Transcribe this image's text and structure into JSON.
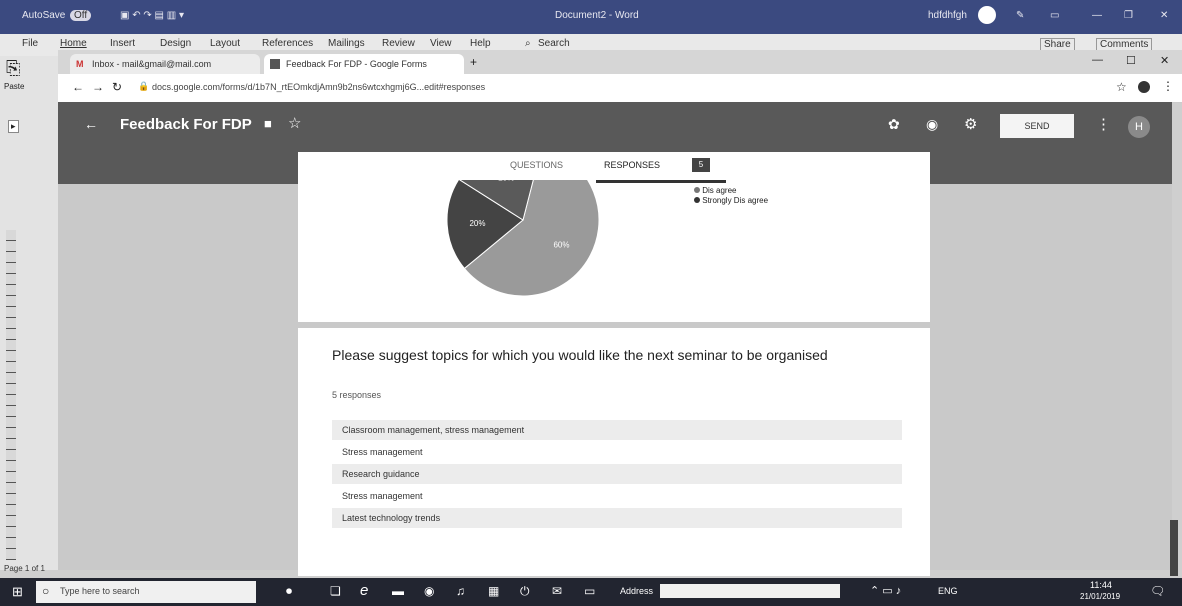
{
  "word": {
    "title": "Document2 - Word",
    "autosave": "AutoSave",
    "autosave_state": "Off",
    "user": "hdfdhfgh",
    "menu": [
      "File",
      "Home",
      "Insert",
      "Design",
      "Layout",
      "References",
      "Mailings",
      "Review",
      "View",
      "Help"
    ],
    "search": "Search",
    "share": "Share",
    "comments": "Comments",
    "paste": "Paste",
    "status_left": "Page 1 of 1"
  },
  "browser": {
    "tabs": [
      {
        "label": "Inbox - mail&gmail@mail.com"
      },
      {
        "label": "Feedback For FDP - Google Forms"
      }
    ],
    "url": "docs.google.com/forms/d/1b7N_rtEOmkdjAmn9b2ns6wtcxhgmj6G...edit#responses"
  },
  "form": {
    "title": "Feedback For FDP",
    "send_label": "SEND",
    "avatar_letter": "H",
    "tabs": {
      "questions": "QUESTIONS",
      "responses": "RESPONSES",
      "responses_count": "5"
    }
  },
  "chart_data": {
    "type": "pie",
    "slices": [
      {
        "label": "",
        "value": 60,
        "color": "#9a9a9a"
      },
      {
        "label": "",
        "value": 20,
        "color": "#444444"
      },
      {
        "label": "",
        "value": 20,
        "color": "#5a5a5a"
      }
    ],
    "slice_labels": [
      "60%",
      "20%",
      "20%"
    ],
    "legend": [
      "Dis agree",
      "Strongly Dis agree"
    ],
    "legend_colors": [
      "#777777",
      "#333333"
    ]
  },
  "question": {
    "text": "Please suggest topics for which you would like the next seminar to be organised",
    "count_label": "5 responses",
    "responses": [
      "Classroom management, stress management",
      "Stress management",
      "Research guidance",
      "Stress management",
      "Latest technology trends"
    ]
  },
  "taskbar": {
    "search_placeholder": "Type here to search",
    "address_label": "Address",
    "time": "11:44",
    "date": "21/01/2019",
    "lang": "ENG"
  }
}
